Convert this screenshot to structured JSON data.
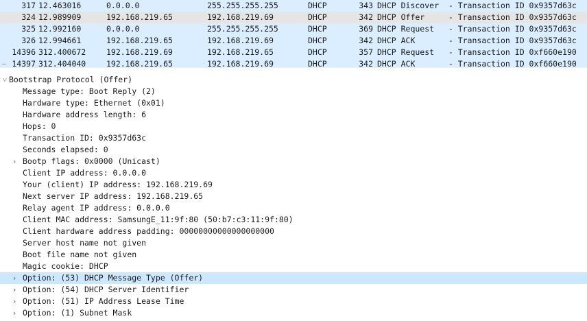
{
  "packet_list": {
    "rows": [
      {
        "no": "317",
        "time": "12.463016",
        "source": "0.0.0.0",
        "destination": "255.255.255.255",
        "protocol": "DHCP",
        "length": "343",
        "info": "DHCP Discover  - Transaction ID 0x9357d63c",
        "gutter": ""
      },
      {
        "no": "324",
        "time": "12.989909",
        "source": "192.168.219.65",
        "destination": "192.168.219.69",
        "protocol": "DHCP",
        "length": "342",
        "info": "DHCP Offer     - Transaction ID 0x9357d63c",
        "gutter": ""
      },
      {
        "no": "325",
        "time": "12.992160",
        "source": "0.0.0.0",
        "destination": "255.255.255.255",
        "protocol": "DHCP",
        "length": "369",
        "info": "DHCP Request   - Transaction ID 0x9357d63c",
        "gutter": ""
      },
      {
        "no": "326",
        "time": "12.994661",
        "source": "192.168.219.65",
        "destination": "192.168.219.69",
        "protocol": "DHCP",
        "length": "342",
        "info": "DHCP ACK       - Transaction ID 0x9357d63c",
        "gutter": ""
      },
      {
        "no": "14396",
        "time": "312.400672",
        "source": "192.168.219.69",
        "destination": "192.168.219.65",
        "protocol": "DHCP",
        "length": "357",
        "info": "DHCP Request   - Transaction ID 0xf660e190",
        "gutter": ""
      },
      {
        "no": "14397",
        "time": "312.404040",
        "source": "192.168.219.65",
        "destination": "192.168.219.69",
        "protocol": "DHCP",
        "length": "342",
        "info": "DHCP ACK       - Transaction ID 0xf660e190",
        "gutter": "–"
      }
    ]
  },
  "details": {
    "protocol_header": "Bootstrap Protocol (Offer)",
    "fields": [
      {
        "text": "Message type: Boot Reply (2)",
        "expandable": false
      },
      {
        "text": "Hardware type: Ethernet (0x01)",
        "expandable": false
      },
      {
        "text": "Hardware address length: 6",
        "expandable": false
      },
      {
        "text": "Hops: 0",
        "expandable": false
      },
      {
        "text": "Transaction ID: 0x9357d63c",
        "expandable": false
      },
      {
        "text": "Seconds elapsed: 0",
        "expandable": false
      },
      {
        "text": "Bootp flags: 0x0000 (Unicast)",
        "expandable": true
      },
      {
        "text": "Client IP address: 0.0.0.0",
        "expandable": false
      },
      {
        "text": "Your (client) IP address: 192.168.219.69",
        "expandable": false
      },
      {
        "text": "Next server IP address: 192.168.219.65",
        "expandable": false
      },
      {
        "text": "Relay agent IP address: 0.0.0.0",
        "expandable": false
      },
      {
        "text": "Client MAC address: SamsungE_11:9f:80 (50:b7:c3:11:9f:80)",
        "expandable": false
      },
      {
        "text": "Client hardware address padding: 00000000000000000000",
        "expandable": false
      },
      {
        "text": "Server host name not given",
        "expandable": false
      },
      {
        "text": "Boot file name not given",
        "expandable": false
      },
      {
        "text": "Magic cookie: DHCP",
        "expandable": false
      },
      {
        "text": "Option: (53) DHCP Message Type (Offer)",
        "expandable": true
      },
      {
        "text": "Option: (54) DHCP Server Identifier",
        "expandable": true
      },
      {
        "text": "Option: (51) IP Address Lease Time",
        "expandable": true
      },
      {
        "text": "Option: (1) Subnet Mask",
        "expandable": true
      }
    ]
  },
  "icons": {
    "expanded": "˅",
    "collapsed": "›"
  },
  "colors": {
    "row_bg": "#daeeff",
    "row_selected_bg": "#e5e5e5",
    "tree_highlight_bg": "#cce8ff"
  }
}
